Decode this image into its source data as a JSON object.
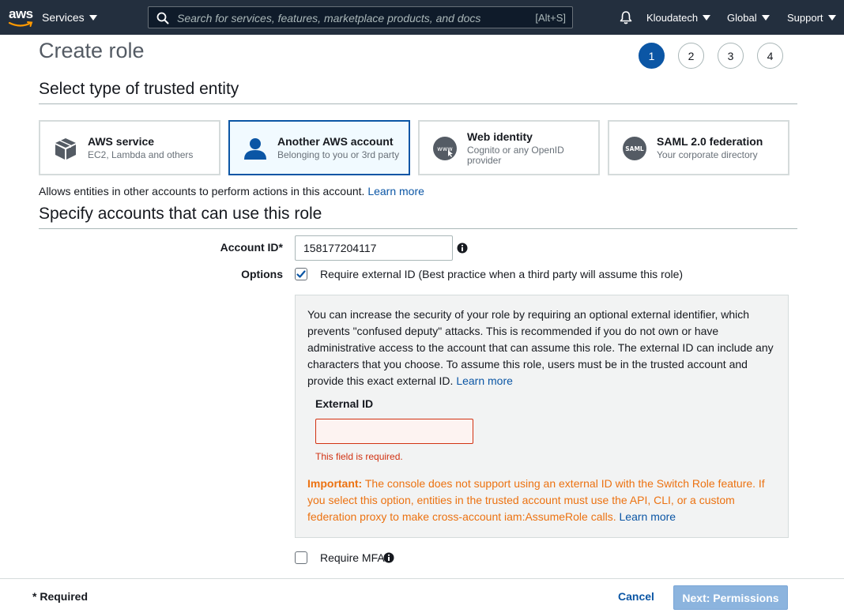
{
  "header": {
    "logo_text": "aws",
    "services_label": "Services",
    "search_placeholder": "Search for services, features, marketplace products, and docs",
    "search_shortcut": "[Alt+S]",
    "account": "Kloudatech",
    "region": "Global",
    "support": "Support"
  },
  "page": {
    "title": "Create role",
    "steps": [
      "1",
      "2",
      "3",
      "4"
    ],
    "active_step": 1
  },
  "trusted_entity": {
    "title": "Select type of trusted entity",
    "options": [
      {
        "title": "AWS service",
        "subtitle": "EC2, Lambda and others",
        "icon": "cube-icon",
        "selected": false
      },
      {
        "title": "Another AWS account",
        "subtitle": "Belonging to you or 3rd party",
        "icon": "user-icon",
        "selected": true
      },
      {
        "title": "Web identity",
        "subtitle": "Cognito or any OpenID provider",
        "icon": "www-icon",
        "selected": false
      },
      {
        "title": "SAML 2.0 federation",
        "subtitle": "Your corporate directory",
        "icon": "saml-icon",
        "selected": false
      }
    ],
    "help_text": "Allows entities in other accounts to perform actions in this account.",
    "help_link": "Learn more"
  },
  "accounts": {
    "title": "Specify accounts that can use this role",
    "account_id_label": "Account ID*",
    "account_id_value": "158177204117",
    "options_label": "Options",
    "require_external_id_label": "Require external ID (Best practice when a third party will assume this role)",
    "require_external_id_checked": true,
    "info_text": "You can increase the security of your role by requiring an optional external identifier, which prevents \"confused deputy\" attacks. This is recommended if you do not own or have administrative access to the account that can assume this role. The external ID can include any characters that you choose. To assume this role, users must be in the trusted account and provide this exact external ID.",
    "info_link": "Learn more",
    "external_id_label": "External ID",
    "external_id_value": "",
    "external_id_error": "This field is required.",
    "important_label": "Important:",
    "important_text": "The console does not support using an external ID with the Switch Role feature. If you select this option, entities in the trusted account must use the API, CLI, or a custom federation proxy to make cross-account iam:AssumeRole calls.",
    "important_link": "Learn more",
    "require_mfa_label": "Require MFA",
    "require_mfa_checked": false
  },
  "footer": {
    "required_note": "* Required",
    "cancel_label": "Cancel",
    "next_label": "Next: Permissions"
  },
  "colors": {
    "header_bg": "#232f3e",
    "accent": "#0b56a5",
    "error": "#d13212",
    "warning": "#ec7211",
    "next_disabled": "#8cb4de"
  }
}
